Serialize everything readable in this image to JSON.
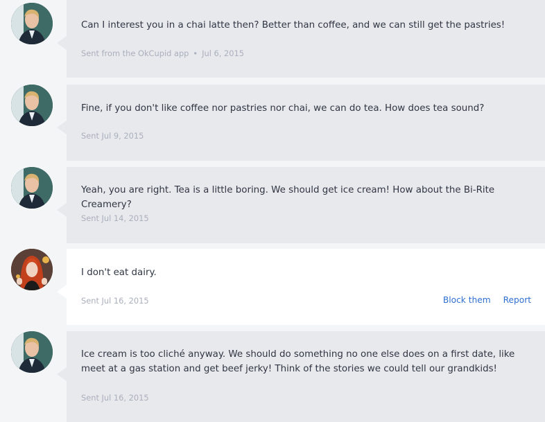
{
  "messages": [
    {
      "sender": "match",
      "text": "Can I interest you in a chai latte then? Better than coffee, and we can still get the pastries!",
      "meta_source": "Sent from the OkCupid app",
      "meta_date": "Jul 6, 2015"
    },
    {
      "sender": "match",
      "text": "Fine, if you don't like coffee nor pastries nor chai, we can do tea. How does tea sound?",
      "meta": "Sent Jul 9, 2015"
    },
    {
      "sender": "match",
      "text": "Yeah, you are right. Tea is a little boring. We should get ice cream! How about the Bi-Rite Creamery?",
      "meta": "Sent Jul 14, 2015"
    },
    {
      "sender": "self",
      "text": "I don't eat dairy.",
      "meta": "Sent Jul 16, 2015",
      "actions": {
        "block": "Block them",
        "report": "Report"
      }
    },
    {
      "sender": "match",
      "text": "Ice cream is too cliché anyway. We should do something no one else does on a first date, like meet at a gas station and get beef jerky! Think of the stories we could tell our grandkids!",
      "meta": "Sent Jul 16, 2015"
    }
  ],
  "colors": {
    "page_bg": "#f4f5f7",
    "match_bubble": "#e8e9ed",
    "self_bubble": "#ffffff",
    "text": "#2f3542",
    "meta": "#a9afbc",
    "link": "#2f6fd1"
  },
  "icons": {
    "match_avatar": "male-avatar-icon",
    "self_avatar": "female-avatar-icon"
  }
}
